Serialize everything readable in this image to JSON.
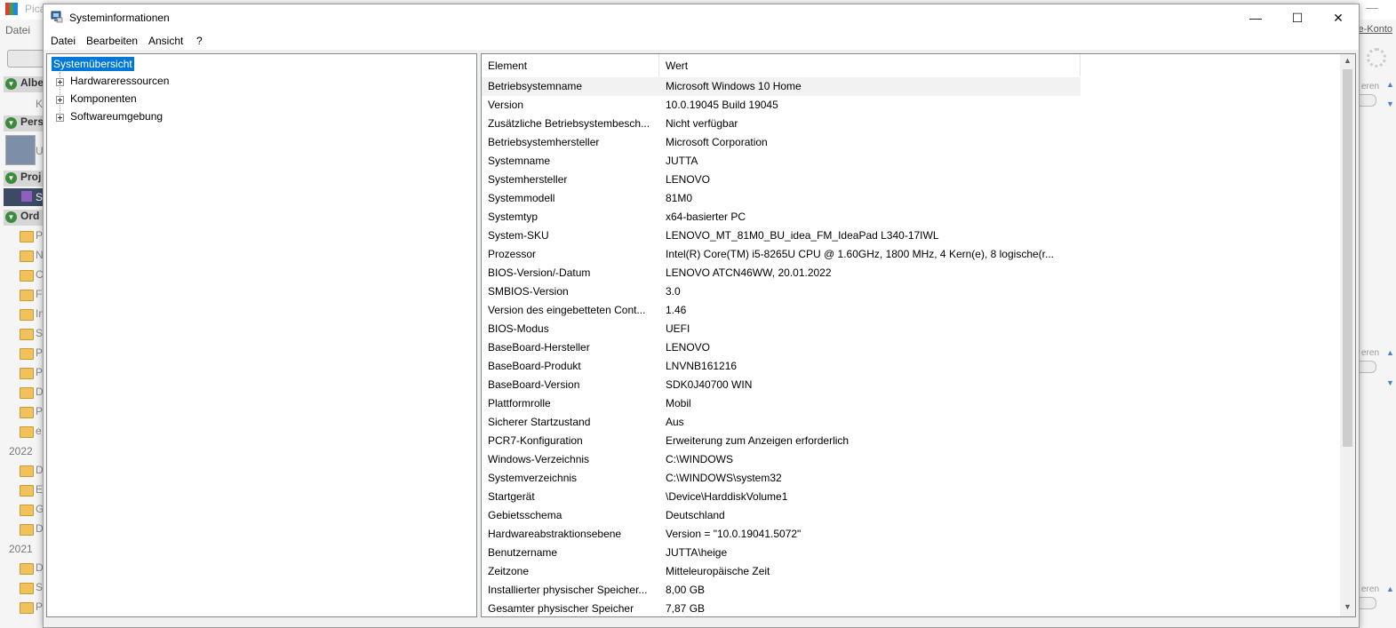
{
  "background_app": {
    "title": "Pica",
    "menu_datei": "Datei",
    "konto_link": "e-Konto",
    "section_headers": [
      "Albe",
      "Pers",
      "Proj",
      "Ord"
    ],
    "year_2022": "2022",
    "year_2021": "2021",
    "folder_letters": [
      "P",
      "N",
      "C",
      "F",
      "In",
      "S",
      "P",
      "P",
      "D",
      "P",
      "e",
      "D",
      "E",
      "G",
      "D",
      "D",
      "S",
      "P"
    ],
    "side_texts": [
      "eren",
      "eren",
      "eren"
    ],
    "item_letters": {
      "album": "K",
      "person": "U",
      "project": "S"
    }
  },
  "window": {
    "title": "Systeminformationen",
    "controls": {
      "minimize": "—",
      "maximize": "☐",
      "close": "✕"
    }
  },
  "menu": {
    "datei": "Datei",
    "bearbeiten": "Bearbeiten",
    "ansicht": "Ansicht",
    "help": "?"
  },
  "tree": {
    "root": "Systemübersicht",
    "items": [
      "Hardwareressourcen",
      "Komponenten",
      "Softwareumgebung"
    ]
  },
  "list": {
    "columns": {
      "element": "Element",
      "wert": "Wert"
    },
    "rows": [
      {
        "element": "Betriebsystemname",
        "wert": "Microsoft Windows 10 Home"
      },
      {
        "element": "Version",
        "wert": "10.0.19045 Build 19045"
      },
      {
        "element": "Zusätzliche Betriebsystembesch...",
        "wert": "Nicht verfügbar"
      },
      {
        "element": "Betriebsystemhersteller",
        "wert": "Microsoft Corporation"
      },
      {
        "element": "Systemname",
        "wert": "JUTTA"
      },
      {
        "element": "Systemhersteller",
        "wert": "LENOVO"
      },
      {
        "element": "Systemmodell",
        "wert": "81M0"
      },
      {
        "element": "Systemtyp",
        "wert": "x64-basierter PC"
      },
      {
        "element": "System-SKU",
        "wert": "LENOVO_MT_81M0_BU_idea_FM_IdeaPad L340-17IWL"
      },
      {
        "element": "Prozessor",
        "wert": "Intel(R) Core(TM) i5-8265U CPU @ 1.60GHz, 1800 MHz, 4 Kern(e), 8 logische(r..."
      },
      {
        "element": "BIOS-Version/-Datum",
        "wert": "LENOVO ATCN46WW, 20.01.2022"
      },
      {
        "element": "SMBIOS-Version",
        "wert": "3.0"
      },
      {
        "element": "Version des eingebetteten Cont...",
        "wert": "1.46"
      },
      {
        "element": "BIOS-Modus",
        "wert": "UEFI"
      },
      {
        "element": "BaseBoard-Hersteller",
        "wert": "LENOVO"
      },
      {
        "element": "BaseBoard-Produkt",
        "wert": "LNVNB161216"
      },
      {
        "element": "BaseBoard-Version",
        "wert": "SDK0J40700 WIN"
      },
      {
        "element": "Plattformrolle",
        "wert": "Mobil"
      },
      {
        "element": "Sicherer Startzustand",
        "wert": "Aus"
      },
      {
        "element": "PCR7-Konfiguration",
        "wert": "Erweiterung zum Anzeigen erforderlich"
      },
      {
        "element": "Windows-Verzeichnis",
        "wert": "C:\\WINDOWS"
      },
      {
        "element": "Systemverzeichnis",
        "wert": "C:\\WINDOWS\\system32"
      },
      {
        "element": "Startgerät",
        "wert": "\\Device\\HarddiskVolume1"
      },
      {
        "element": "Gebietsschema",
        "wert": "Deutschland"
      },
      {
        "element": "Hardwareabstraktionsebene",
        "wert": "Version = \"10.0.19041.5072\""
      },
      {
        "element": "Benutzername",
        "wert": "JUTTA\\heige"
      },
      {
        "element": "Zeitzone",
        "wert": "Mitteleuropäische Zeit"
      },
      {
        "element": "Installierter physischer Speicher...",
        "wert": "8,00 GB"
      },
      {
        "element": "Gesamter physischer Speicher",
        "wert": "7,87 GB"
      }
    ]
  },
  "colors": {
    "selection": "#0078d7",
    "first_row": "#f2f2f2",
    "border": "#828790"
  }
}
